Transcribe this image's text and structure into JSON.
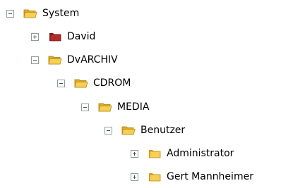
{
  "tree": {
    "nodes": [
      {
        "label": "System",
        "state": "expanded",
        "folder_color": "yellow"
      },
      {
        "label": "David",
        "state": "collapsed",
        "folder_color": "red"
      },
      {
        "label": "DvARCHIV",
        "state": "expanded",
        "folder_color": "yellow"
      },
      {
        "label": "CDROM",
        "state": "expanded",
        "folder_color": "yellow"
      },
      {
        "label": "MEDIA",
        "state": "expanded",
        "folder_color": "yellow"
      },
      {
        "label": "Benutzer",
        "state": "expanded",
        "folder_color": "yellow"
      },
      {
        "label": "Administrator",
        "state": "collapsed",
        "folder_color": "yellow"
      },
      {
        "label": "Gert Mannheimer",
        "state": "collapsed",
        "folder_color": "yellow"
      }
    ]
  },
  "colors": {
    "folder_yellow": "#f7cf52",
    "folder_red": "#b22a2a",
    "toggle_border": "#919b9c"
  }
}
